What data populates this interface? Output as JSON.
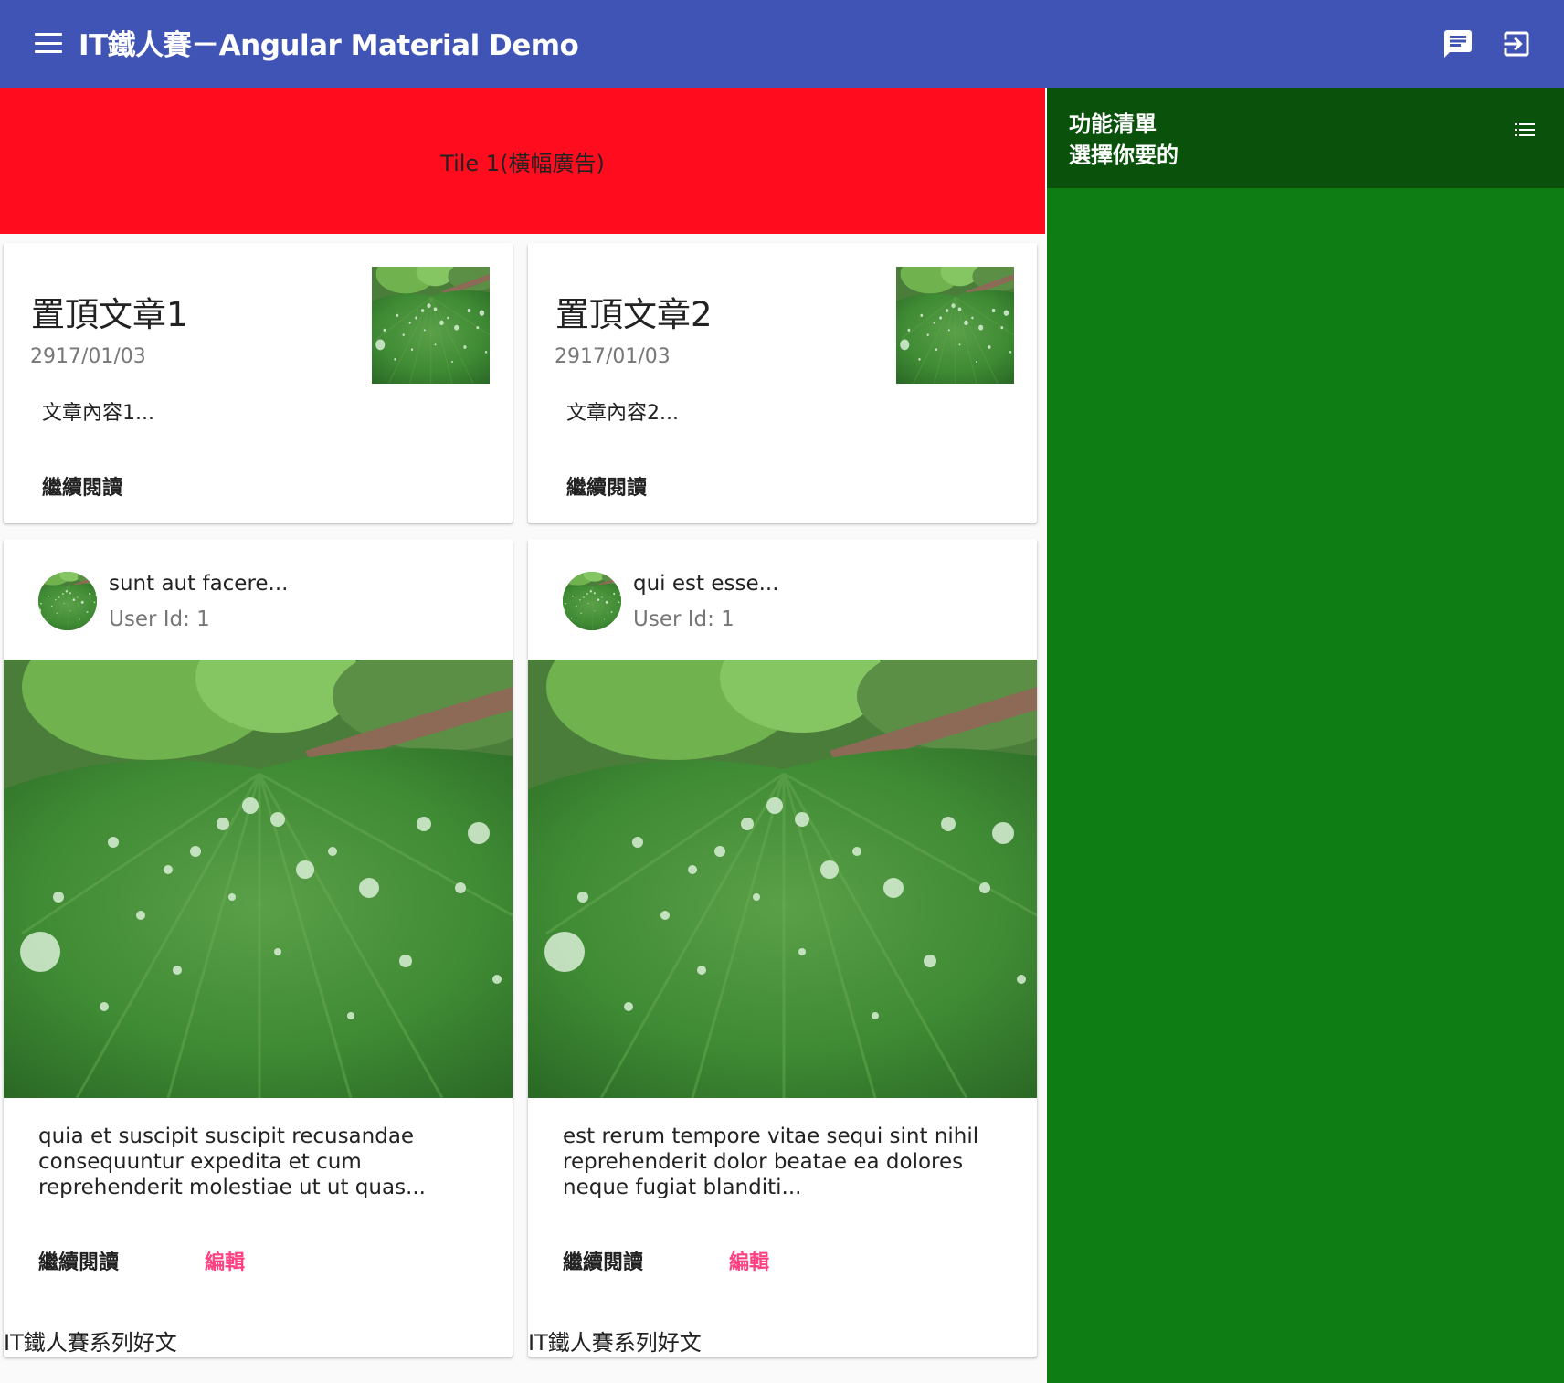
{
  "toolbar": {
    "title": "IT鐵人賽－Angular Material Demo",
    "menu_icon": "menu-icon",
    "chat_icon": "chat-icon",
    "exit_icon": "exit-to-app-icon",
    "background": "#4054b5"
  },
  "banner": {
    "text": "Tile 1(橫幅廣告)",
    "background": "#ff0c1e"
  },
  "featured": [
    {
      "title": "置頂文章1",
      "date": "2917/01/03",
      "body": "文章內容1...",
      "read_more": "繼續閱讀"
    },
    {
      "title": "置頂文章2",
      "date": "2917/01/03",
      "body": "文章內容2...",
      "read_more": "繼續閱讀"
    }
  ],
  "posts": [
    {
      "title": "sunt aut facere...",
      "subtitle": "User Id: 1",
      "body": "quia et suscipit suscipit recusandae consequuntur expedita et cum reprehenderit molestiae ut ut quas...",
      "read_more": "繼續閱讀",
      "edit": "編輯",
      "footer": "IT鐵人賽系列好文"
    },
    {
      "title": "qui est esse...",
      "subtitle": "User Id: 1",
      "body": "est rerum tempore vitae sequi sint nihil reprehenderit dolor beatae ea dolores neque fugiat blanditi...",
      "read_more": "繼續閱讀",
      "edit": "編輯",
      "footer": "IT鐵人賽系列好文"
    }
  ],
  "sidenav": {
    "title": "功能清單",
    "subtitle": "選擇你要的",
    "list_icon": "list-icon",
    "header_color": "#0a520b",
    "background": "#0e7d13"
  },
  "colors": {
    "accent": "#ff4081"
  }
}
